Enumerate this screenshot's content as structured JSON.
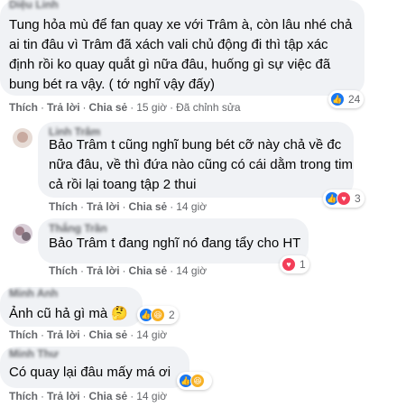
{
  "actions": {
    "like": "Thích",
    "reply": "Trả lời",
    "share": "Chia sẻ",
    "sep": "·"
  },
  "comments": [
    {
      "name": "Diệu Linh",
      "lines": [
        "Tung hỏa mù để fan quay xe với Trâm à, còn lâu nhé chả",
        "ai tin đâu vì Trâm đã xách vali chủ động đi thì tập xác",
        "định rồi ko quay quắt gì nữa đâu, huống gì sự việc đã",
        "bung bét ra vậy. ( tớ nghĩ vậy đấy)"
      ],
      "time": "15 giờ",
      "edited": "Đã chỉnh sửa",
      "reactions": {
        "icons": [
          "like-icon"
        ],
        "count": "24"
      }
    },
    {
      "name": "Linh Trâm",
      "lines": [
        "Bảo Trâm t cũng nghĩ bung bét cỡ này chả về đc",
        "nữa đâu, về thì đứa nào cũng có cái dằm trong tim",
        "cả rồi lại toang tập 2 thui"
      ],
      "time": "14 giờ",
      "reactions": {
        "icons": [
          "like-icon",
          "love-icon"
        ],
        "count": "3"
      }
    },
    {
      "name": "Thắng Trần",
      "lines": [
        "Bảo Trâm t đang nghĩ nó đang tẩy cho HT"
      ],
      "time": "14 giờ",
      "reactions": {
        "icons": [
          "love-icon"
        ],
        "count": "1"
      }
    },
    {
      "name": "Minh Anh",
      "lines": [
        "Ảnh cũ hả gì mà 🤔"
      ],
      "time": "14 giờ",
      "reactions": {
        "icons": [
          "like-icon",
          "haha-icon"
        ],
        "count": "2"
      }
    },
    {
      "name": "Minh Thư",
      "lines": [
        "Có quay lại đâu mấy má ơi"
      ],
      "time": "14 giờ",
      "reactions": {
        "icons": [
          "like-icon",
          "haha-icon"
        ],
        "count": ""
      }
    }
  ],
  "colors": {
    "like": "#1877f2",
    "love": "#f33e58",
    "haha": "#f7b125",
    "bubble": "#f0f2f5",
    "meta": "#65676b"
  }
}
